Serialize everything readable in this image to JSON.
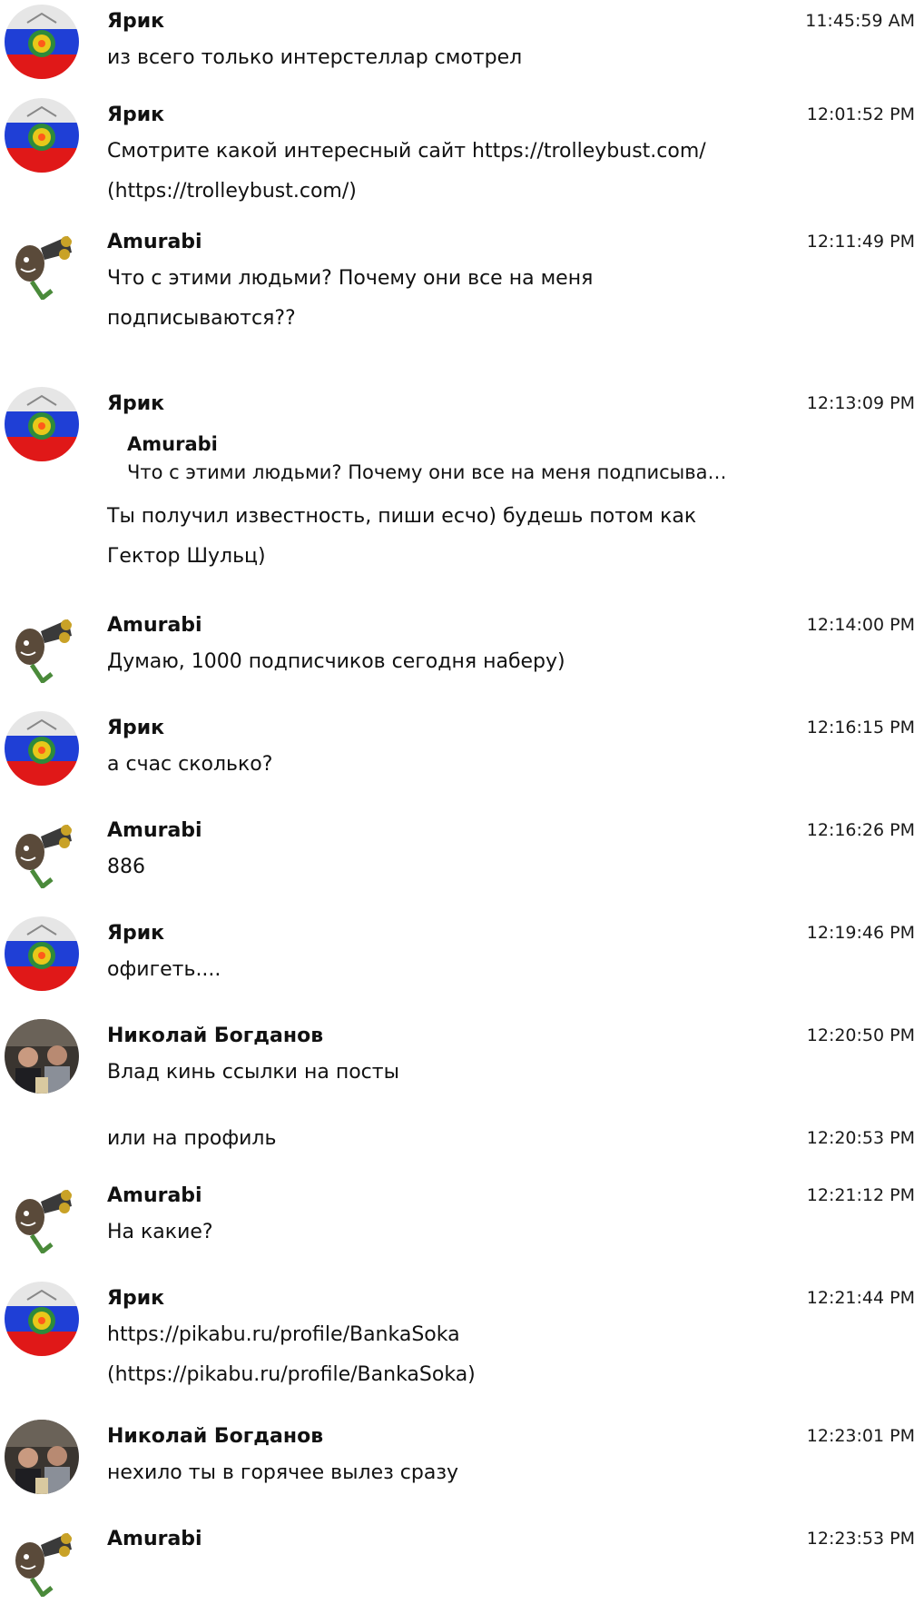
{
  "messages": [
    {
      "author": "Ярик",
      "avatar": "russia-emblem-avatar",
      "time": "11:45:59 AM",
      "text": "из всего только интерстеллар смотрел"
    },
    {
      "author": "Ярик",
      "avatar": "russia-emblem-avatar",
      "time": "12:01:52 PM",
      "text": "Смотрите какой интересный сайт https://trolleybust.com/\n(https://trolleybust.com/)"
    },
    {
      "author": "Amurabi",
      "avatar": "cartoon-character-avatar",
      "time": "12:11:49 PM",
      "text": "Что с этими людьми? Почему они все на меня\nподписываются??"
    },
    {
      "author": "Ярик",
      "avatar": "russia-emblem-avatar",
      "time": "12:13:09 PM",
      "quote": {
        "author": "Amurabi",
        "text": "Что с этими людьми? Почему они все на меня подписыва…"
      },
      "text": "Ты получил известность, пиши есчо) будешь потом как\nГектор Шульц)"
    },
    {
      "author": "Amurabi",
      "avatar": "cartoon-character-avatar",
      "time": "12:14:00 PM",
      "text": "Думаю, 1000 подписчиков сегодня наберу)"
    },
    {
      "author": "Ярик",
      "avatar": "russia-emblem-avatar",
      "time": "12:16:15 PM",
      "text": "а счас сколько?"
    },
    {
      "author": "Amurabi",
      "avatar": "cartoon-character-avatar",
      "time": "12:16:26 PM",
      "text": "886"
    },
    {
      "author": "Ярик",
      "avatar": "russia-emblem-avatar",
      "time": "12:19:46 PM",
      "text": "офигеть...."
    },
    {
      "author": "Николай Богданов",
      "avatar": "photo-avatar",
      "time": "12:20:50 PM",
      "text": "Влад кинь ссылки на посты"
    },
    {
      "author": "",
      "avatar": "",
      "time": "12:20:53 PM",
      "text": "или на профиль"
    },
    {
      "author": "Amurabi",
      "avatar": "cartoon-character-avatar",
      "time": "12:21:12 PM",
      "text": "На какие?"
    },
    {
      "author": "Ярик",
      "avatar": "russia-emblem-avatar",
      "time": "12:21:44 PM",
      "text": "https://pikabu.ru/profile/BankaSoka\n(https://pikabu.ru/profile/BankaSoka)"
    },
    {
      "author": "Николай Богданов",
      "avatar": "photo-avatar",
      "time": "12:23:01 PM",
      "text": "нехило ты в горячее вылез сразу"
    },
    {
      "author": "Amurabi",
      "avatar": "cartoon-character-avatar",
      "time": "12:23:53 PM",
      "text": ""
    }
  ]
}
